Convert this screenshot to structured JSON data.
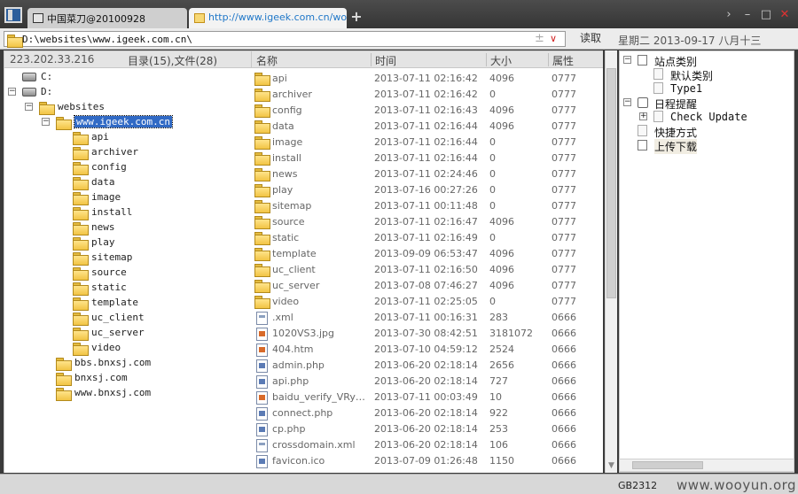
{
  "tabs": [
    {
      "title": "中国菜刀@20100928",
      "active": false
    },
    {
      "title": "http://www.igeek.com.cn/wo...",
      "active": true
    }
  ],
  "new_tab_label": "+",
  "window_controls": {
    "nav": "›",
    "minimize": "–",
    "maximize": "□",
    "close": "✕"
  },
  "address": {
    "value": "D:\\websites\\www.igeek.com.cn\\",
    "read_label": "读取"
  },
  "date_display": "星期二 2013-09-17 八月十三",
  "left_panel": {
    "ip": "223.202.33.216",
    "summary": "目录(15),文件(28)",
    "tree": [
      {
        "label": "C:",
        "kind": "drive",
        "depth": 0,
        "expander": ""
      },
      {
        "label": "D:",
        "kind": "drive",
        "depth": 0,
        "expander": "−"
      },
      {
        "label": "websites",
        "kind": "folder",
        "depth": 1,
        "expander": "−"
      },
      {
        "label": "www.igeek.com.cn",
        "kind": "folder",
        "depth": 2,
        "expander": "−",
        "selected": true
      },
      {
        "label": "api",
        "kind": "folder",
        "depth": 3
      },
      {
        "label": "archiver",
        "kind": "folder",
        "depth": 3
      },
      {
        "label": "config",
        "kind": "folder",
        "depth": 3
      },
      {
        "label": "data",
        "kind": "folder",
        "depth": 3
      },
      {
        "label": "image",
        "kind": "folder",
        "depth": 3
      },
      {
        "label": "install",
        "kind": "folder",
        "depth": 3
      },
      {
        "label": "news",
        "kind": "folder",
        "depth": 3
      },
      {
        "label": "play",
        "kind": "folder",
        "depth": 3
      },
      {
        "label": "sitemap",
        "kind": "folder",
        "depth": 3
      },
      {
        "label": "source",
        "kind": "folder",
        "depth": 3
      },
      {
        "label": "static",
        "kind": "folder",
        "depth": 3
      },
      {
        "label": "template",
        "kind": "folder",
        "depth": 3
      },
      {
        "label": "uc_client",
        "kind": "folder",
        "depth": 3
      },
      {
        "label": "uc_server",
        "kind": "folder",
        "depth": 3
      },
      {
        "label": "video",
        "kind": "folder",
        "depth": 3
      },
      {
        "label": "bbs.bnxsj.com",
        "kind": "folder",
        "depth": 2
      },
      {
        "label": "bnxsj.com",
        "kind": "folder",
        "depth": 2
      },
      {
        "label": "www.bnxsj.com",
        "kind": "folder",
        "depth": 2
      }
    ]
  },
  "file_list": {
    "columns": {
      "name": "名称",
      "time": "时间",
      "size": "大小",
      "attr": "属性"
    },
    "rows": [
      {
        "name": "api",
        "time": "2013-07-11 02:16:42",
        "size": "4096",
        "attr": "0777",
        "type": "folder"
      },
      {
        "name": "archiver",
        "time": "2013-07-11 02:16:42",
        "size": "0",
        "attr": "0777",
        "type": "folder"
      },
      {
        "name": "config",
        "time": "2013-07-11 02:16:43",
        "size": "4096",
        "attr": "0777",
        "type": "folder"
      },
      {
        "name": "data",
        "time": "2013-07-11 02:16:44",
        "size": "4096",
        "attr": "0777",
        "type": "folder"
      },
      {
        "name": "image",
        "time": "2013-07-11 02:16:44",
        "size": "0",
        "attr": "0777",
        "type": "folder"
      },
      {
        "name": "install",
        "time": "2013-07-11 02:16:44",
        "size": "0",
        "attr": "0777",
        "type": "folder"
      },
      {
        "name": "news",
        "time": "2013-07-11 02:24:46",
        "size": "0",
        "attr": "0777",
        "type": "folder"
      },
      {
        "name": "play",
        "time": "2013-07-16 00:27:26",
        "size": "0",
        "attr": "0777",
        "type": "folder"
      },
      {
        "name": "sitemap",
        "time": "2013-07-11 00:11:48",
        "size": "0",
        "attr": "0777",
        "type": "folder"
      },
      {
        "name": "source",
        "time": "2013-07-11 02:16:47",
        "size": "4096",
        "attr": "0777",
        "type": "folder"
      },
      {
        "name": "static",
        "time": "2013-07-11 02:16:49",
        "size": "0",
        "attr": "0777",
        "type": "folder"
      },
      {
        "name": "template",
        "time": "2013-09-09 06:53:47",
        "size": "4096",
        "attr": "0777",
        "type": "folder"
      },
      {
        "name": "uc_client",
        "time": "2013-07-11 02:16:50",
        "size": "4096",
        "attr": "0777",
        "type": "folder"
      },
      {
        "name": "uc_server",
        "time": "2013-07-08 07:46:27",
        "size": "4096",
        "attr": "0777",
        "type": "folder"
      },
      {
        "name": "video",
        "time": "2013-07-11 02:25:05",
        "size": "0",
        "attr": "0777",
        "type": "folder"
      },
      {
        "name": ".xml",
        "time": "2013-07-11 00:16:31",
        "size": "283",
        "attr": "0666",
        "type": "xml"
      },
      {
        "name": "1020VS3.jpg",
        "time": "2013-07-30 08:42:51",
        "size": "3181072",
        "attr": "0666",
        "type": "img"
      },
      {
        "name": "404.htm",
        "time": "2013-07-10 04:59:12",
        "size": "2524",
        "attr": "0666",
        "type": "img"
      },
      {
        "name": "admin.php",
        "time": "2013-06-20 02:18:14",
        "size": "2656",
        "attr": "0666",
        "type": "file"
      },
      {
        "name": "api.php",
        "time": "2013-06-20 02:18:14",
        "size": "727",
        "attr": "0666",
        "type": "file"
      },
      {
        "name": "baidu_verify_VRyAKJ...",
        "time": "2013-07-11 00:03:49",
        "size": "10",
        "attr": "0666",
        "type": "img"
      },
      {
        "name": "connect.php",
        "time": "2013-06-20 02:18:14",
        "size": "922",
        "attr": "0666",
        "type": "file"
      },
      {
        "name": "cp.php",
        "time": "2013-06-20 02:18:14",
        "size": "253",
        "attr": "0666",
        "type": "file"
      },
      {
        "name": "crossdomain.xml",
        "time": "2013-06-20 02:18:14",
        "size": "106",
        "attr": "0666",
        "type": "xml"
      },
      {
        "name": "favicon.ico",
        "time": "2013-07-09 01:26:48",
        "size": "1150",
        "attr": "0666",
        "type": "file"
      }
    ]
  },
  "right_panel": {
    "items": [
      {
        "label": "站点类别",
        "depth": 0,
        "expander": "−",
        "icon": "box"
      },
      {
        "label": "默认类别",
        "depth": 1,
        "expander": "",
        "icon": "doc"
      },
      {
        "label": "Type1",
        "depth": 1,
        "expander": "",
        "icon": "doc"
      },
      {
        "label": "日程提醒",
        "depth": 0,
        "expander": "−",
        "icon": "clock"
      },
      {
        "label": "Check Update",
        "depth": 1,
        "expander": "+",
        "icon": "doc"
      },
      {
        "label": "快捷方式",
        "depth": 0,
        "expander": "",
        "icon": "doc"
      },
      {
        "label": "上传下载",
        "depth": 0,
        "expander": "",
        "icon": "box",
        "highlight": true
      }
    ]
  },
  "status": {
    "encoding": "GB2312",
    "watermark": "www.wooyun.org"
  }
}
